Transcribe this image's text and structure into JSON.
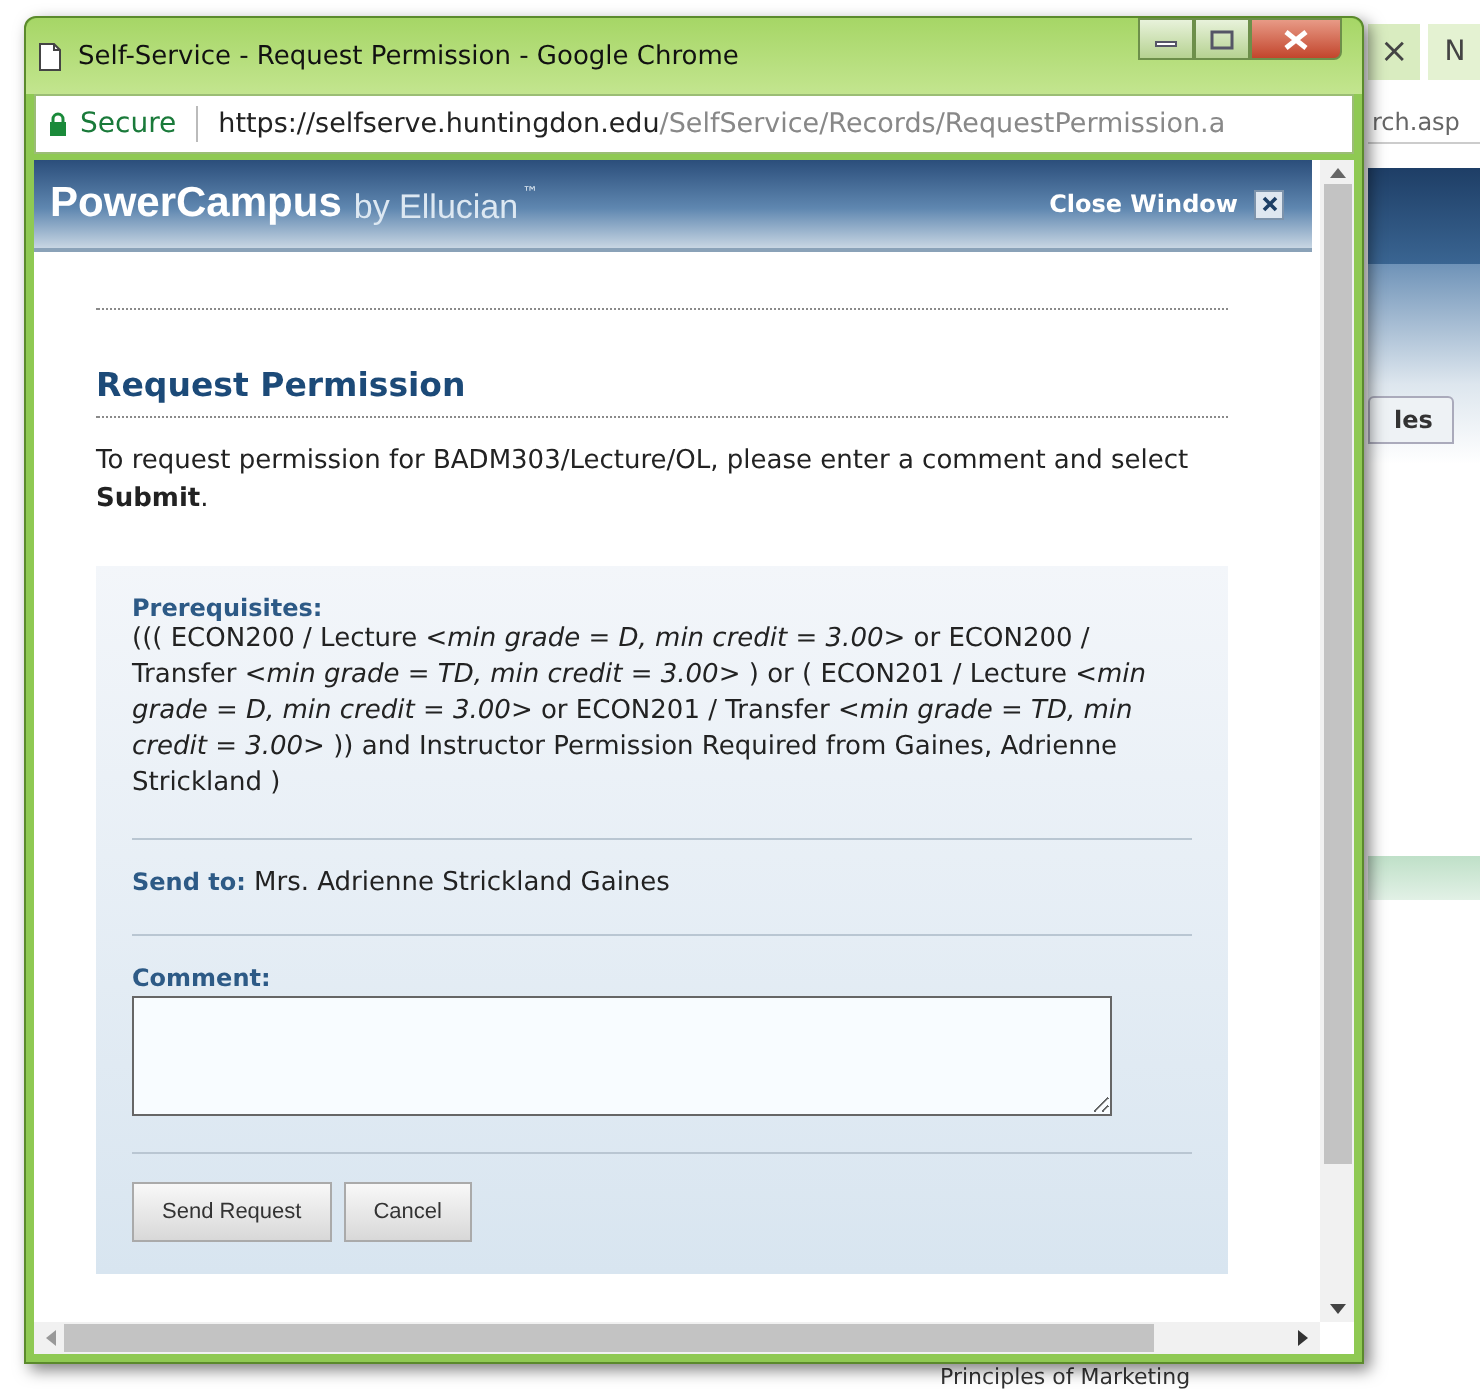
{
  "background": {
    "tab_close": "×",
    "tab_title": "N",
    "address_fragment": "rch.asp",
    "tab_label": "les",
    "footer_text": "Principles of Marketing"
  },
  "window": {
    "title": "Self-Service - Request Permission - Google Chrome"
  },
  "address_bar": {
    "secure_label": "Secure",
    "url_host": "https://selfserve.huntingdon.edu",
    "url_path": "/SelfService/Records/RequestPermission.a"
  },
  "header": {
    "brand": "PowerCampus",
    "brand_sub": "by Ellucian",
    "trademark": "™",
    "close_label": "Close Window"
  },
  "page": {
    "heading": "Request Permission",
    "intro": "To request permission for BADM303/Lecture/OL, please enter a comment and select **Submit**.",
    "prerequisites": {
      "label": "Prerequisites:",
      "text": "((( ECON200 / Lecture *<min grade = D, min credit = 3.00>* or ECON200 / Transfer *<min grade = TD, min credit = 3.00>* ) or ( ECON201 / Lecture *<min grade = D, min credit = 3.00>* or ECON201 / Transfer *<min grade = TD, min credit = 3.00>* )) and Instructor Permission Required from Gaines, Adrienne Strickland )"
    },
    "send_to": {
      "label": "Send to:",
      "value": "Mrs. Adrienne Strickland Gaines"
    },
    "comment": {
      "label": "Comment:"
    },
    "buttons": [
      "Send Request",
      "Cancel"
    ]
  }
}
